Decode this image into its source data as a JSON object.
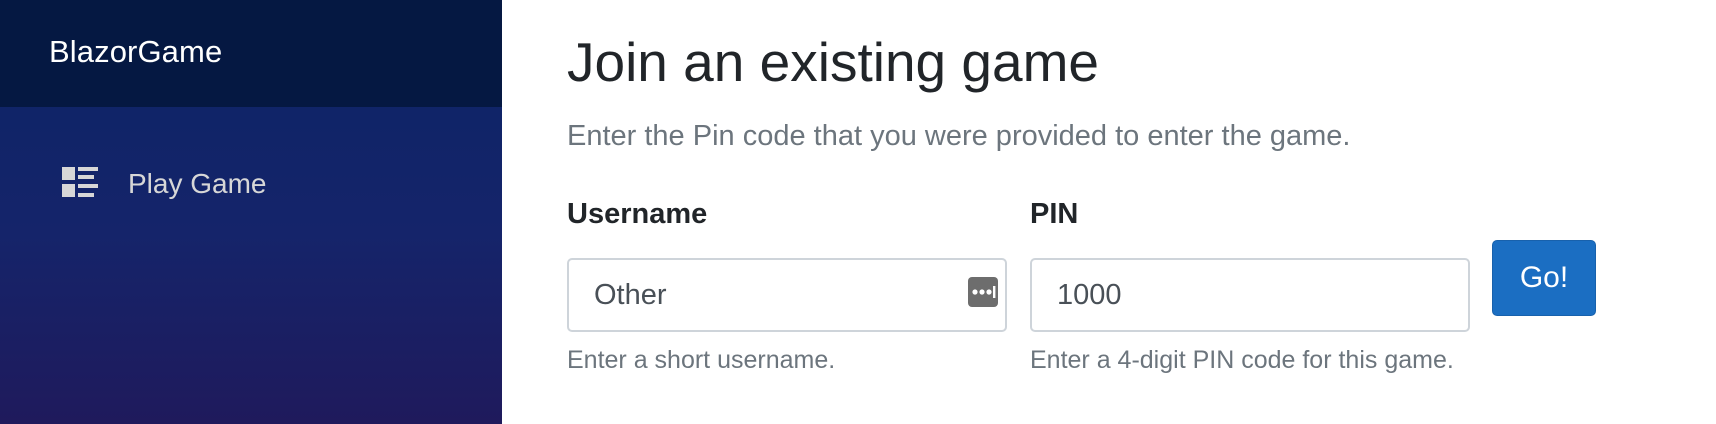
{
  "sidebar": {
    "brand": "BlazorGame",
    "items": [
      {
        "label": "Play Game",
        "icon": "list-rich-icon"
      }
    ]
  },
  "main": {
    "title": "Join an existing game",
    "subtitle": "Enter the Pin code that you were provided to enter the game.",
    "username": {
      "label": "Username",
      "value": "Other",
      "hint": "Enter a short username.",
      "autofill_icon": "password-manager-icon"
    },
    "pin": {
      "label": "PIN",
      "value": "1000",
      "hint": "Enter a 4-digit PIN code for this game."
    },
    "go_button": "Go!"
  },
  "colors": {
    "sidebar_top": "#051842",
    "sidebar_gradient_start": "#0b2466",
    "sidebar_gradient_end": "#1f1a5c",
    "primary_button": "#1b6ec2",
    "muted_text": "#6c757d"
  }
}
